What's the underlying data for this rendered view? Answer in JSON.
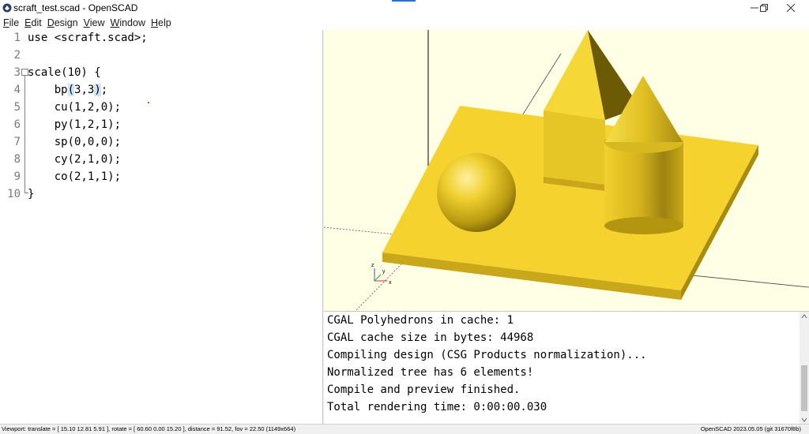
{
  "window": {
    "title": "scraft_test.scad - OpenSCAD",
    "app_icon": "openscad-icon"
  },
  "menu": [
    {
      "u": "F",
      "rest": "ile"
    },
    {
      "u": "E",
      "rest": "dit"
    },
    {
      "u": "D",
      "rest": "esign"
    },
    {
      "u": "V",
      "rest": "iew"
    },
    {
      "u": "W",
      "rest": "indow"
    },
    {
      "u": "H",
      "rest": "elp"
    }
  ],
  "editor": {
    "lines": [
      {
        "n": "1",
        "text": "use <scraft.scad>;"
      },
      {
        "n": "2",
        "text": ""
      },
      {
        "n": "3",
        "text": "scale(10) {"
      },
      {
        "n": "4",
        "pre": "    bp",
        "h1": "(",
        "mid": "3,3",
        "h2": ")",
        "post": ";"
      },
      {
        "n": "5",
        "text": "    cu(1,2,0);"
      },
      {
        "n": "6",
        "text": "    py(1,2,1);"
      },
      {
        "n": "7",
        "text": "    sp(0,0,0);"
      },
      {
        "n": "8",
        "text": "    cy(2,1,0);"
      },
      {
        "n": "9",
        "text": "    co(2,1,1);"
      },
      {
        "n": "10",
        "text": "}"
      }
    ]
  },
  "viewport": {
    "axis_labels": {
      "z": "z",
      "y": "y",
      "x": "x"
    },
    "colors": {
      "background": "#ffffe5",
      "model": "#f5d22e"
    }
  },
  "console": {
    "lines": [
      "CGAL Polyhedrons in cache: 1",
      "CGAL cache size in bytes: 44968",
      "Compiling design (CSG Products normalization)...",
      "Normalized tree has 6 elements!",
      "Compile and preview finished.",
      "Total rendering time: 0:00:00.030"
    ]
  },
  "status": {
    "left": "Viewport: translate = [ 15.10 12.81 5.91 ], rotate = [ 60.60 0.00 15.20 ], distance = 91.52, fov = 22.50 (1149x664)",
    "right": "OpenSCAD 2023.05.05 (git 31670f8b)"
  }
}
